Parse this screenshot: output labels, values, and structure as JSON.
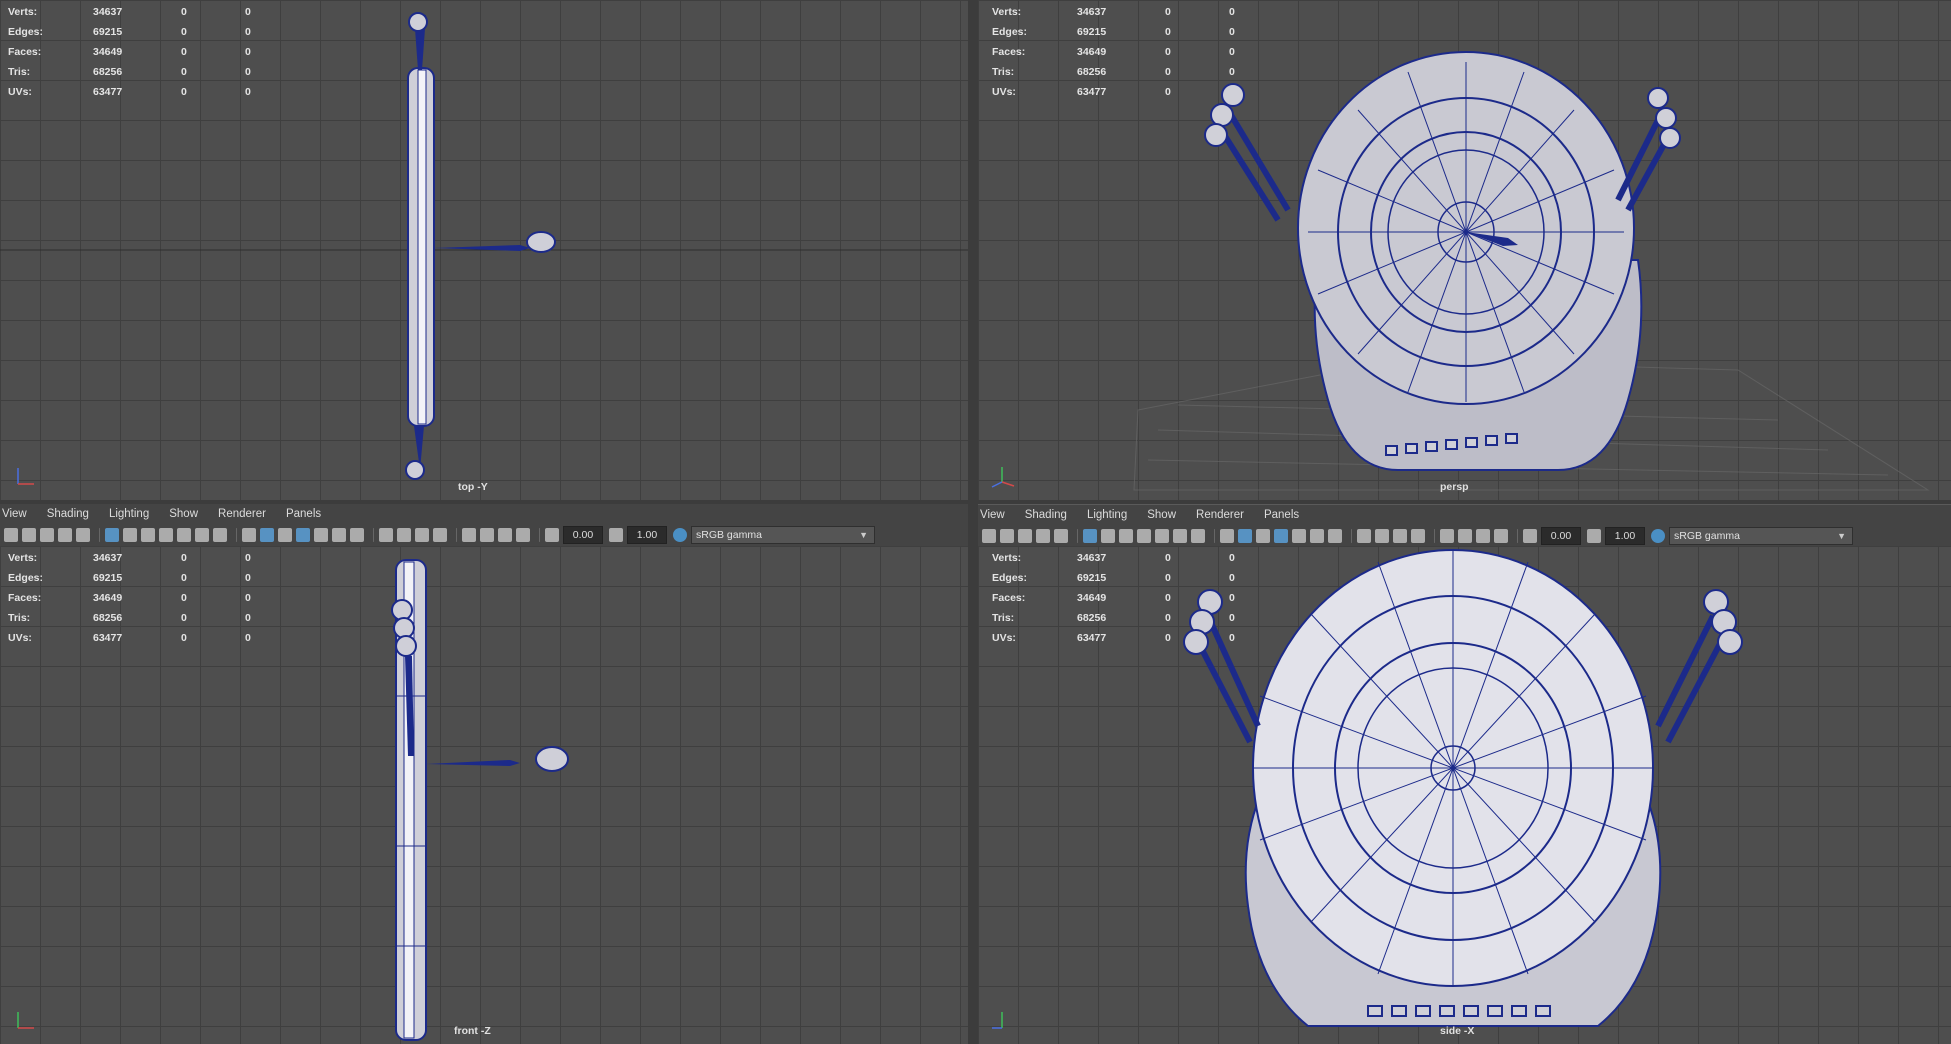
{
  "hud": {
    "rows": [
      {
        "label": "Verts:",
        "a": "34637",
        "b": "0",
        "c": "0"
      },
      {
        "label": "Edges:",
        "a": "69215",
        "b": "0",
        "c": "0"
      },
      {
        "label": "Faces:",
        "a": "34649",
        "b": "0",
        "c": "0"
      },
      {
        "label": "Tris:",
        "a": "68256",
        "b": "0",
        "c": "0"
      },
      {
        "label": "UVs:",
        "a": "63477",
        "b": "0",
        "c": "0"
      }
    ]
  },
  "viewports": {
    "top": {
      "label": "top -Y"
    },
    "persp": {
      "label": "persp"
    },
    "front": {
      "label": "front -Z"
    },
    "side": {
      "label": "side -X"
    }
  },
  "panel_menu": [
    "View",
    "Shading",
    "Lighting",
    "Show",
    "Renderer",
    "Panels"
  ],
  "toolbar": {
    "exposure": "0.00",
    "gamma": "1.00",
    "color_space": "sRGB gamma"
  },
  "icons": {
    "axis": "axis-gizmo-icon",
    "exposure": "exposure-icon",
    "gamma": "gamma-icon",
    "colorspace": "color-management-icon",
    "dropdown": "chevron-down-icon"
  },
  "colors": {
    "viewport_bg": "#4e4e4e",
    "grid": "#3f3f3f",
    "wire": "#1c2a8a",
    "mesh_fill": "#d9d9d9"
  }
}
